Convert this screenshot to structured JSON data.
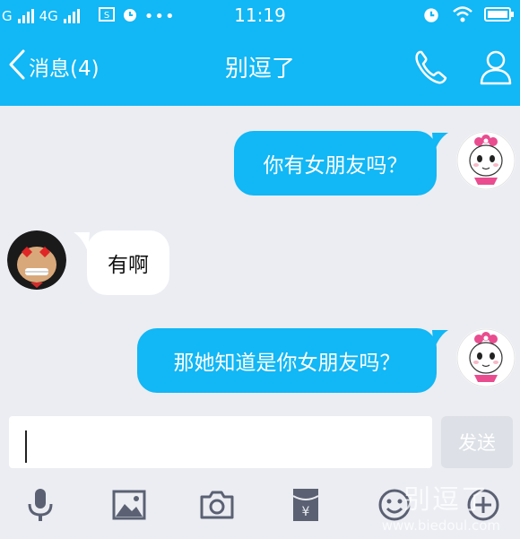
{
  "status_bar": {
    "carrier_1": "G",
    "carrier_2": "4G",
    "time": "11:19",
    "accent": "#12b7f5",
    "icons": [
      "signal-icon",
      "signal-icon",
      "sim-icon",
      "alarm-icon",
      "more-icon",
      "alarm-icon",
      "wifi-icon",
      "battery-icon"
    ]
  },
  "nav": {
    "back_label": "消息(4)",
    "title": "别逗了",
    "icons": [
      "chevron-left-icon",
      "phone-icon",
      "profile-icon"
    ]
  },
  "messages": [
    {
      "direction": "out",
      "text": "你有女朋友吗？",
      "avatar": "girl-avatar"
    },
    {
      "direction": "in",
      "text": "有啊",
      "avatar": "monkey-avatar"
    },
    {
      "direction": "out",
      "text": "那她知道是你女朋友吗？",
      "avatar": "girl-avatar"
    }
  ],
  "input": {
    "value": "",
    "send_label": "发送"
  },
  "toolbar": {
    "items": [
      "microphone-icon",
      "image-icon",
      "camera-icon",
      "red-packet-icon",
      "emoji-icon",
      "plus-icon"
    ]
  },
  "watermark": {
    "text": "别逗了",
    "url": "www.biedoul.com"
  },
  "colors": {
    "brand": "#12b7f5",
    "chat_background": "#ebedf2",
    "bubble_in": "#ffffff",
    "send_disabled": "#dde0e6"
  }
}
